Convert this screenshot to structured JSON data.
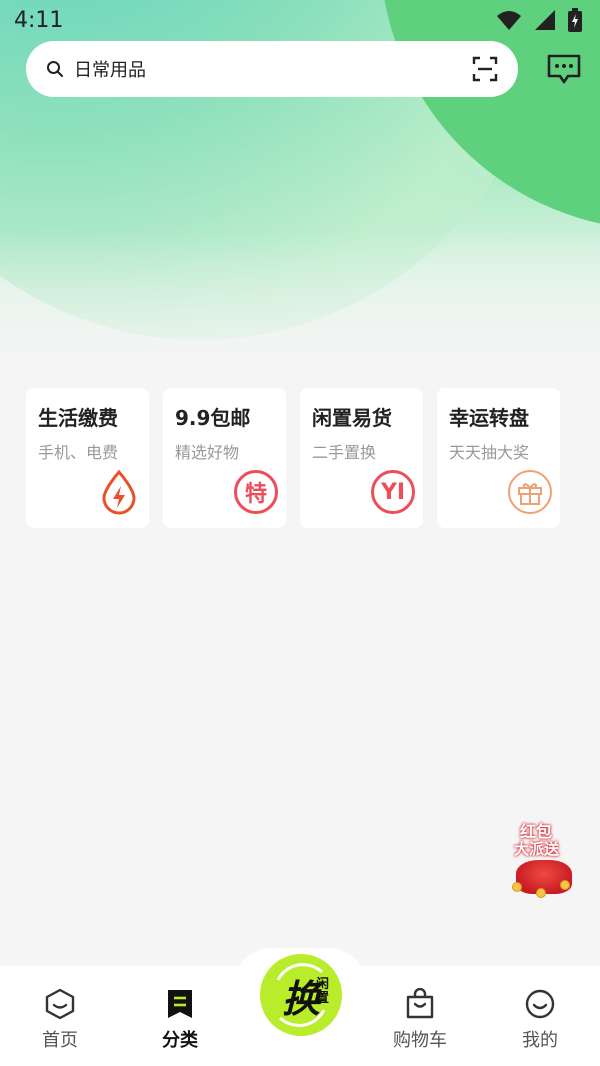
{
  "status": {
    "time": "4:11"
  },
  "search": {
    "text": "日常用品"
  },
  "cards": [
    {
      "title": "生活缴费",
      "sub": "手机、电费",
      "icon": "lightning-drop-icon"
    },
    {
      "title": "9.9包邮",
      "sub": "精选好物",
      "icon_text": "特"
    },
    {
      "title": "闲置易货",
      "sub": "二手置换",
      "icon_text": "YI"
    },
    {
      "title": "幸运转盘",
      "sub": "天天抽大奖",
      "icon": "gift-icon"
    }
  ],
  "promo": {
    "line1": "红包",
    "line2": "大派送"
  },
  "nav": {
    "home": "首页",
    "category": "分类",
    "center_main": "换",
    "center_small": "闲置",
    "cart": "购物车",
    "mine": "我的"
  },
  "colors": {
    "accent_green": "#5fd07d",
    "center_button": "#b9ec2a",
    "red": "#ee4d58",
    "orange": "#f1a074"
  }
}
